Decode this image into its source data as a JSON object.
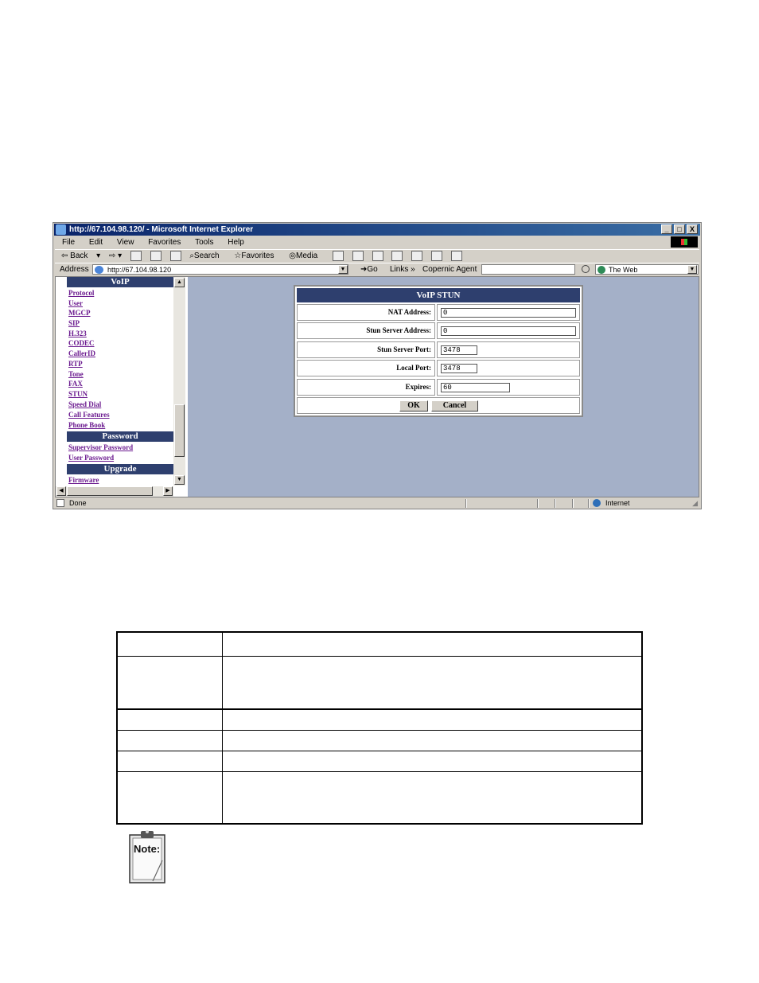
{
  "window": {
    "title": "http://67.104.98.120/ - Microsoft Internet Explorer",
    "buttons": {
      "minimize": "_",
      "maximize": "□",
      "close": "X"
    }
  },
  "menu": [
    "File",
    "Edit",
    "View",
    "Favorites",
    "Tools",
    "Help"
  ],
  "toolbar": {
    "back": "Back",
    "search": "Search",
    "favorites": "Favorites",
    "media": "Media"
  },
  "addressbar": {
    "label": "Address",
    "url": "http://67.104.98.120",
    "go": "Go",
    "links": "Links",
    "copernic": "Copernic Agent",
    "search_scope": "The Web"
  },
  "nav": {
    "voip_heading": "VoIP",
    "voip_links": [
      "Protocol",
      "User",
      "MGCP",
      "SIP",
      "H.323",
      "CODEC",
      "CallerID",
      "RTP",
      "Tone",
      "FAX",
      "STUN",
      "Speed Dial",
      "Call Features",
      "Phone Book"
    ],
    "password_heading": "Password",
    "password_links": [
      "Supervisor Password",
      "User Password"
    ],
    "upgrade_heading": "Upgrade",
    "upgrade_links": [
      "Firmware"
    ]
  },
  "stun_form": {
    "title": "VoIP STUN",
    "fields": [
      {
        "label": "NAT Address:",
        "value": "0"
      },
      {
        "label": "Stun Server Address:",
        "value": "0"
      },
      {
        "label": "Stun Server Port:",
        "value": "3478"
      },
      {
        "label": "Local Port:",
        "value": "3478"
      },
      {
        "label": "Expires:",
        "value": "60"
      }
    ],
    "ok": "OK",
    "cancel": "Cancel"
  },
  "status": {
    "text": "Done",
    "zone": "Internet"
  },
  "note_icon": {
    "label": "Note:"
  }
}
